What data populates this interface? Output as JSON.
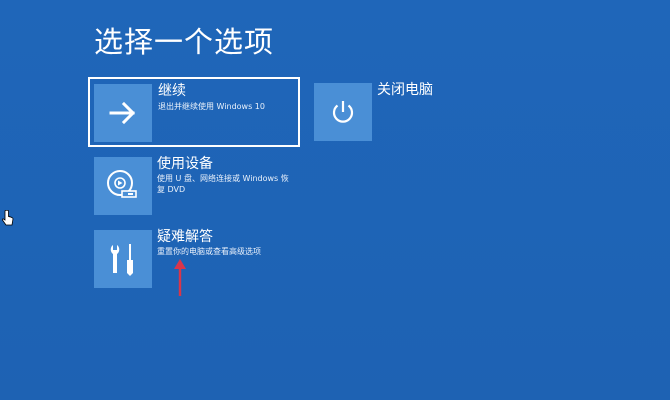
{
  "page": {
    "title": "选择一个选项"
  },
  "options": {
    "continue": {
      "title": "继续",
      "description": "退出并继续使用 Windows 10",
      "icon": "arrow-right-icon"
    },
    "shutdown": {
      "title": "关闭电脑",
      "icon": "power-icon"
    },
    "device": {
      "title": "使用设备",
      "description": "使用 U 盘、网络连接或 Windows 恢复 DVD",
      "icon": "disc-drive-icon"
    },
    "troubleshoot": {
      "title": "疑难解答",
      "description": "重置你的电脑或查看高级选项",
      "icon": "tools-icon"
    }
  },
  "colors": {
    "background": "#1f64b7",
    "tile": "#4a8fd6",
    "annotation_arrow": "#d9364a"
  }
}
